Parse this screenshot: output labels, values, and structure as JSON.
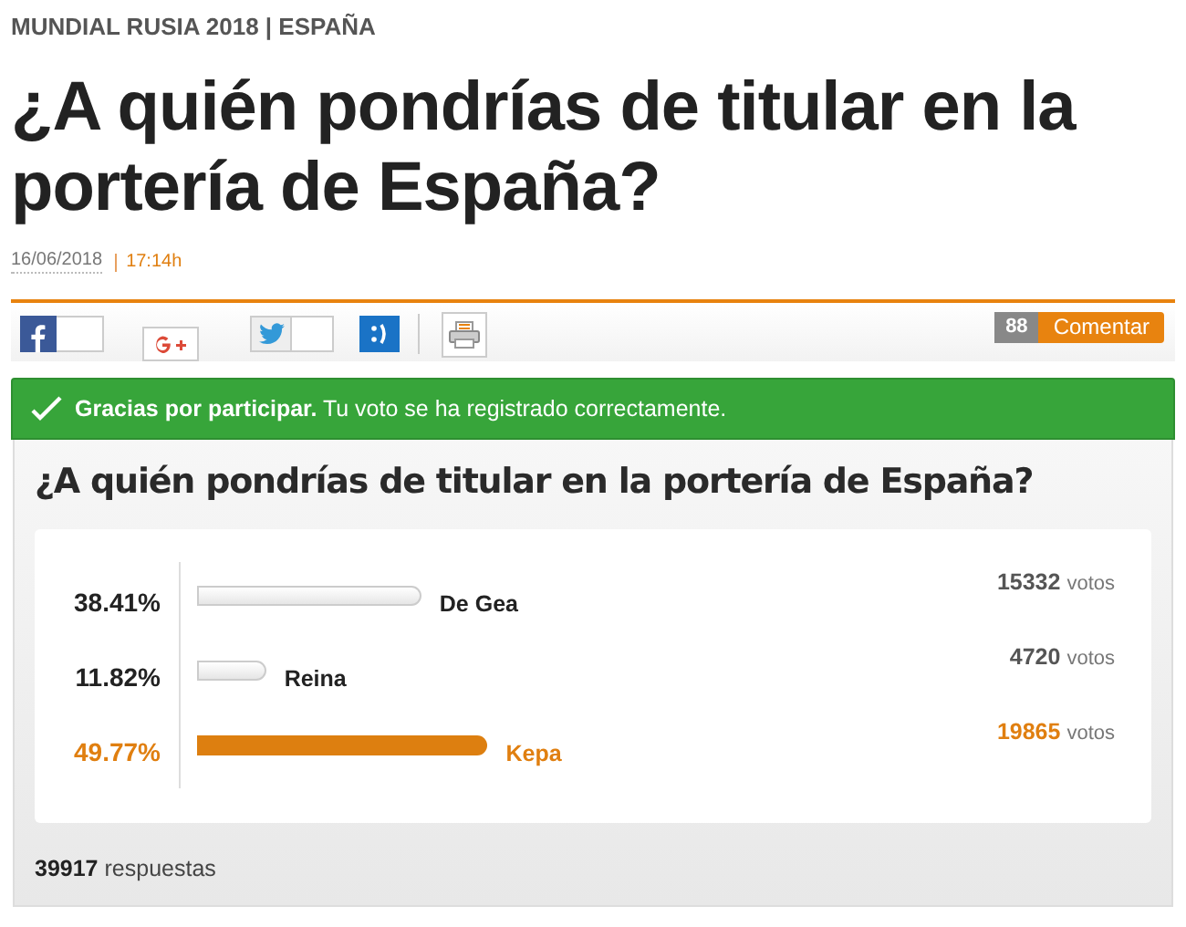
{
  "section": "MUNDIAL RUSIA 2018 | ESPAÑA",
  "headline": "¿A quién pondrías de titular en la portería de España?",
  "date": "16/06/2018",
  "time": "17:14h",
  "share": {
    "comment_count": "88",
    "comment_button": "Comentar"
  },
  "notice": {
    "bold": "Gracias por participar.",
    "text": "Tu voto se ha registrado correctamente."
  },
  "poll": {
    "question": "¿A quién pondrías de titular en la portería de España?",
    "options": [
      {
        "percent": "38.41%",
        "name": "De Gea",
        "votes": "15332",
        "votes_label": "votos",
        "selected": false
      },
      {
        "percent": "11.82%",
        "name": "Reina",
        "votes": "4720",
        "votes_label": "votos",
        "selected": false
      },
      {
        "percent": "49.77%",
        "name": "Kepa",
        "votes": "19865",
        "votes_label": "votos",
        "selected": true
      }
    ],
    "total": "39917",
    "total_label": "respuestas"
  }
}
